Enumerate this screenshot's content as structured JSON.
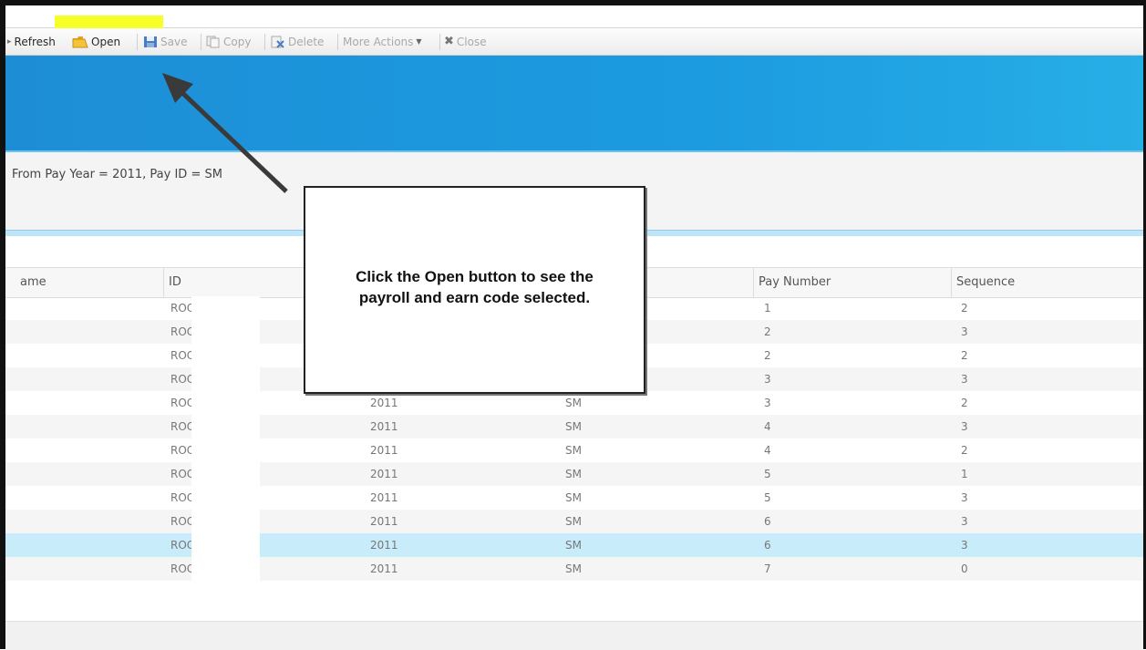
{
  "toolbar": {
    "refresh": "Refresh",
    "open": "Open",
    "save": "Save",
    "copy": "Copy",
    "delete": "Delete",
    "more_actions": "More Actions",
    "close": "Close"
  },
  "filter": {
    "text": "From Pay Year = 2011, Pay ID = SM"
  },
  "grid": {
    "headers": [
      "ame",
      "ID",
      "Pay Number",
      "Sequence"
    ],
    "rows": [
      {
        "id": "ROC",
        "year": "",
        "pay_id": "",
        "pay_number": "1",
        "sequence": "2"
      },
      {
        "id": "ROC",
        "year": "",
        "pay_id": "",
        "pay_number": "2",
        "sequence": "3"
      },
      {
        "id": "ROC",
        "year": "",
        "pay_id": "",
        "pay_number": "2",
        "sequence": "2"
      },
      {
        "id": "ROC",
        "year": "",
        "pay_id": "",
        "pay_number": "3",
        "sequence": "3"
      },
      {
        "id": "ROC",
        "year": "2011",
        "pay_id": "SM",
        "pay_number": "3",
        "sequence": "2"
      },
      {
        "id": "ROC",
        "year": "2011",
        "pay_id": "SM",
        "pay_number": "4",
        "sequence": "3"
      },
      {
        "id": "ROC",
        "year": "2011",
        "pay_id": "SM",
        "pay_number": "4",
        "sequence": "2"
      },
      {
        "id": "ROC",
        "year": "2011",
        "pay_id": "SM",
        "pay_number": "5",
        "sequence": "1"
      },
      {
        "id": "ROC",
        "year": "2011",
        "pay_id": "SM",
        "pay_number": "5",
        "sequence": "3"
      },
      {
        "id": "ROC",
        "year": "2011",
        "pay_id": "SM",
        "pay_number": "6",
        "sequence": "3"
      },
      {
        "id": "ROC",
        "year": "2011",
        "pay_id": "SM",
        "pay_number": "6",
        "sequence": "3"
      },
      {
        "id": "ROC",
        "year": "2011",
        "pay_id": "SM",
        "pay_number": "7",
        "sequence": "0"
      }
    ]
  },
  "callout": {
    "line1": "Click the Open button to see the",
    "line2": "payroll and earn code selected."
  },
  "colors": {
    "highlight": "#f7ff29",
    "banner": "#1c9be0",
    "selected_row": "#c9ecfa"
  }
}
